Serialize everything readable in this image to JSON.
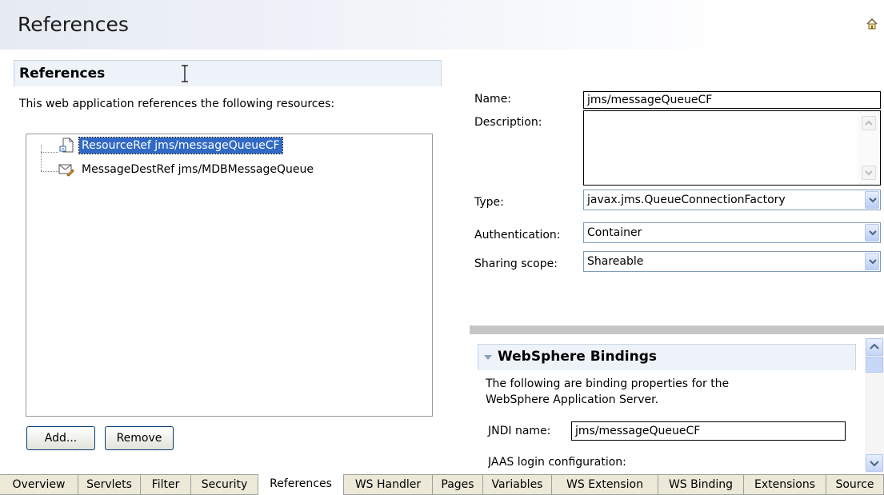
{
  "page": {
    "title": "References"
  },
  "references_section": {
    "title": "References",
    "description": "This web application references the following resources:",
    "tree": [
      {
        "label": "ResourceRef jms/messageQueueCF",
        "icon": "resource-ref-icon",
        "selected": true
      },
      {
        "label": "MessageDestRef jms/MDBMessageQueue",
        "icon": "message-dest-ref-icon",
        "selected": false
      }
    ],
    "add_label": "Add...",
    "remove_label": "Remove"
  },
  "details": {
    "name_label": "Name:",
    "name_value": "jms/messageQueueCF",
    "description_label": "Description:",
    "description_value": "",
    "type_label": "Type:",
    "type_value": "javax.jms.QueueConnectionFactory",
    "auth_label": "Authentication:",
    "auth_value": "Container",
    "sharing_label": "Sharing scope:",
    "sharing_value": "Shareable"
  },
  "bindings": {
    "title": "WebSphere Bindings",
    "desc_line1": "The following are binding properties for the",
    "desc_line2": "WebSphere Application Server.",
    "jndi_label": "JNDI name:",
    "jndi_value": "jms/messageQueueCF",
    "jaas_label": "JAAS login configuration:"
  },
  "tabs": [
    {
      "label": "Overview"
    },
    {
      "label": "Servlets"
    },
    {
      "label": "Filter"
    },
    {
      "label": "Security"
    },
    {
      "label": "References",
      "active": true
    },
    {
      "label": "WS Handler"
    },
    {
      "label": "Pages"
    },
    {
      "label": "Variables"
    },
    {
      "label": "WS Extension"
    },
    {
      "label": "WS Binding"
    },
    {
      "label": "Extensions"
    },
    {
      "label": "Source"
    }
  ],
  "colors": {
    "selection": "#316ac5",
    "section_bg": "#eef3f9",
    "tab_bg": "#ece9d8"
  }
}
